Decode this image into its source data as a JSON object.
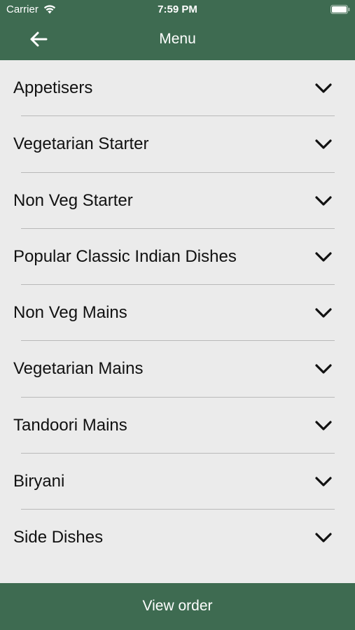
{
  "status_bar": {
    "carrier": "Carrier",
    "time": "7:59 PM",
    "icons": [
      "wifi-icon",
      "battery-icon"
    ]
  },
  "nav": {
    "title": "Menu",
    "back_icon": "arrow-left-icon"
  },
  "menu": {
    "items": [
      {
        "label": "Appetisers"
      },
      {
        "label": "Vegetarian Starter"
      },
      {
        "label": "Non Veg Starter"
      },
      {
        "label": "Popular Classic Indian Dishes"
      },
      {
        "label": "Non Veg Mains"
      },
      {
        "label": "Vegetarian Mains"
      },
      {
        "label": "Tandoori Mains"
      },
      {
        "label": "Biryani"
      },
      {
        "label": "Side Dishes"
      }
    ],
    "expand_icon": "chevron-down-icon"
  },
  "footer": {
    "label": "View order"
  },
  "colors": {
    "brand": "#3e6b51",
    "background": "#ebebeb",
    "divider": "#b9b9b9",
    "text": "#111111"
  }
}
